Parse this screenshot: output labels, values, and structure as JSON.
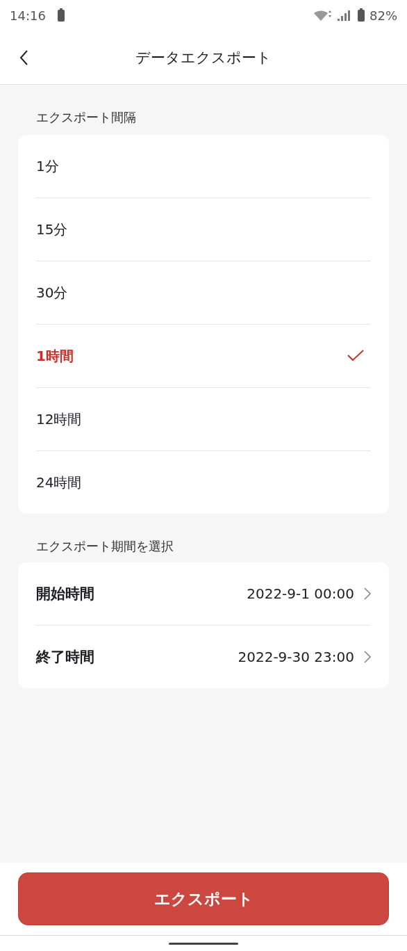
{
  "status_bar": {
    "time": "14:16",
    "battery": "82%"
  },
  "header": {
    "title": "データエクスポート"
  },
  "interval_section": {
    "label": "エクスポート間隔",
    "options": [
      {
        "label": "1分",
        "selected": false
      },
      {
        "label": "15分",
        "selected": false
      },
      {
        "label": "30分",
        "selected": false
      },
      {
        "label": "1時間",
        "selected": true
      },
      {
        "label": "12時間",
        "selected": false
      },
      {
        "label": "24時間",
        "selected": false
      }
    ]
  },
  "period_section": {
    "label": "エクスポート期間を選択",
    "rows": [
      {
        "label": "開始時間",
        "value": "2022-9-1 00:00"
      },
      {
        "label": "終了時間",
        "value": "2022-9-30 23:00"
      }
    ]
  },
  "export_button": "エクスポート"
}
